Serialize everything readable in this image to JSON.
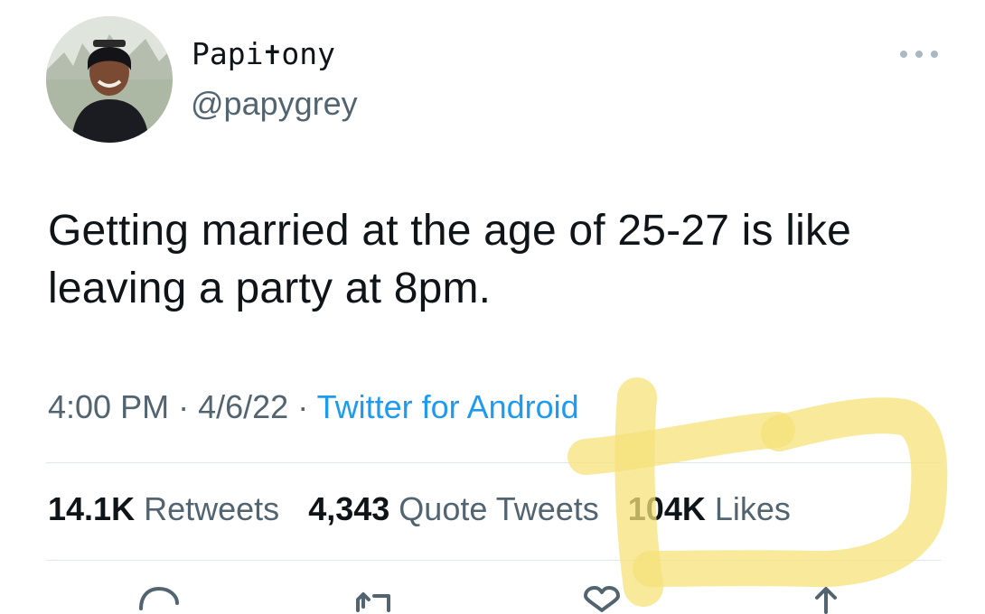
{
  "user": {
    "display_name": "Papi✝ony",
    "handle": "@papygrey",
    "avatar_icon": "profile-photo"
  },
  "tweet": {
    "text": "Getting married at the age of 25-27 is like leaving a party at 8pm."
  },
  "meta": {
    "time": "4:00 PM",
    "date": "4/6/22",
    "separator": "·",
    "source": "Twitter for Android"
  },
  "stats": {
    "retweets_count": "14.1K",
    "retweets_label": "Retweets",
    "quotes_count": "4,343",
    "quotes_label": "Quote Tweets",
    "likes_count": "104K",
    "likes_label": "Likes"
  },
  "actions": [
    "reply-icon",
    "retweet-icon",
    "like-icon",
    "share-icon"
  ],
  "colors": {
    "text": "#0f1419",
    "secondary": "#536471",
    "link": "#1d9bf0",
    "divider": "#e1e8ed",
    "highlighter": "#f5e27a"
  }
}
